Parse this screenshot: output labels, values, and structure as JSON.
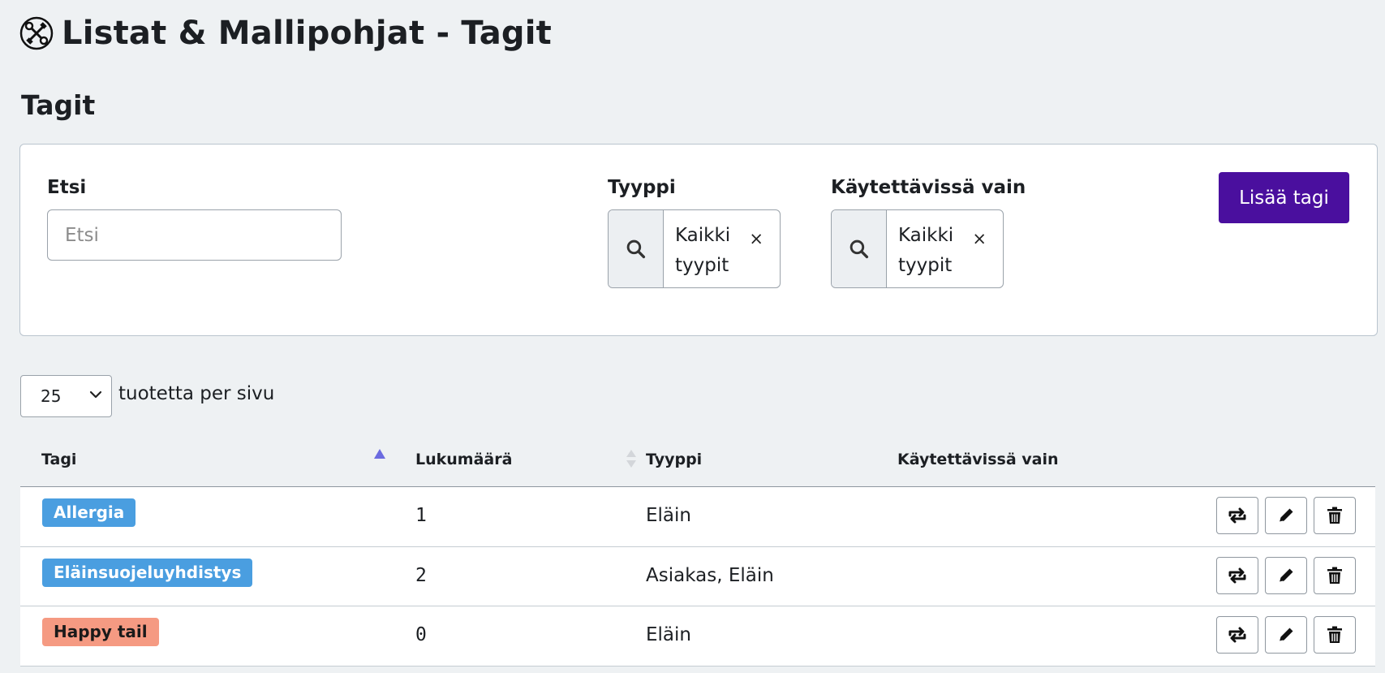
{
  "page": {
    "title": "Listat & Mallipohjat - Tagit",
    "section_title": "Tagit"
  },
  "filters": {
    "search_label": "Etsi",
    "search_placeholder": "Etsi",
    "type_label": "Tyyppi",
    "type_value": "Kaikki tyypit",
    "usable_label": "Käytettävissä vain",
    "usable_value": "Kaikki tyypit",
    "clear_glyph": "×",
    "add_button_label": "Lisää tagi",
    "add_button_color": "#4a0f9e"
  },
  "pagination": {
    "page_size": "25",
    "page_size_label": "tuotetta per sivu"
  },
  "table": {
    "headers": {
      "tag": "Tagi",
      "count": "Lukumäärä",
      "type": "Tyyppi",
      "usable": "Käytettävissä vain"
    },
    "sort": {
      "column": "tag",
      "direction": "asc",
      "accent": "#6b6be0"
    },
    "rows": [
      {
        "tag": "Allergia",
        "tag_color": "#4a9ee0",
        "tag_text_color": "#ffffff",
        "count": "1",
        "type": "Eläin",
        "usable": ""
      },
      {
        "tag": "Eläinsuojeluyhdistys",
        "tag_color": "#4a9ee0",
        "tag_text_color": "#ffffff",
        "count": "2",
        "type": "Asiakas, Eläin",
        "usable": ""
      },
      {
        "tag": "Happy tail",
        "tag_color": "#f59a82",
        "tag_text_color": "#1a1a1a",
        "count": "0",
        "type": "Eläin",
        "usable": ""
      }
    ],
    "row_actions": [
      "repeat-icon",
      "pencil-icon",
      "trash-icon"
    ]
  }
}
